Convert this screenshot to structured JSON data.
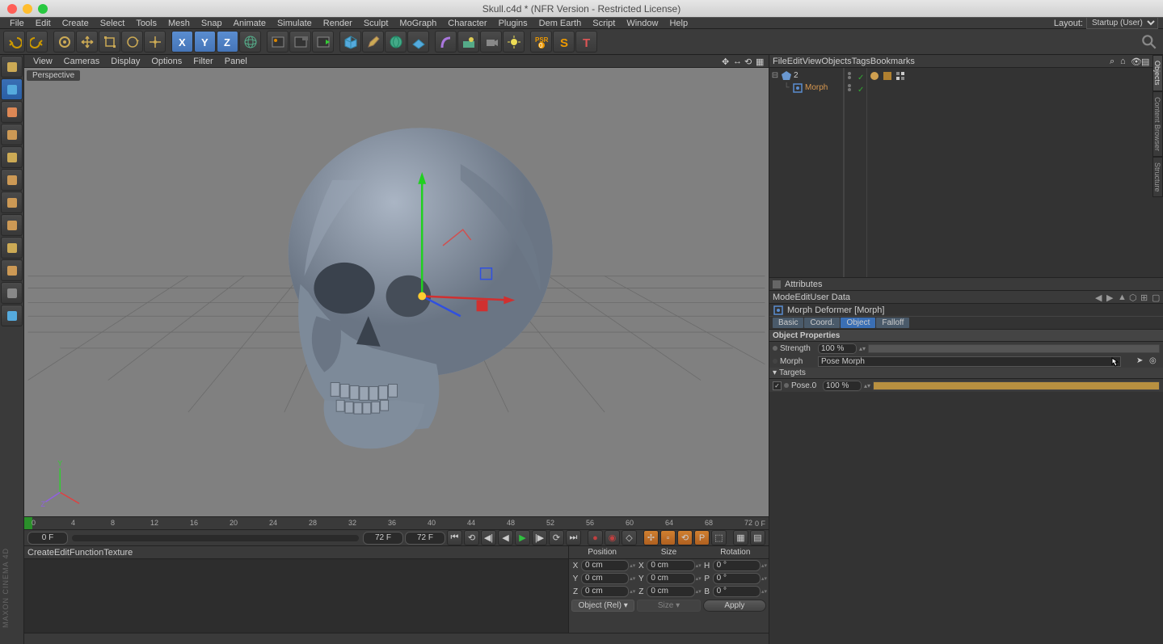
{
  "titlebar": {
    "title": "Skull.c4d * (NFR Version - Restricted License)"
  },
  "menubar": {
    "items": [
      "File",
      "Edit",
      "Create",
      "Select",
      "Tools",
      "Mesh",
      "Snap",
      "Animate",
      "Simulate",
      "Render",
      "Sculpt",
      "MoGraph",
      "Character",
      "Plugins",
      "Dem Earth",
      "Script",
      "Window",
      "Help"
    ],
    "layout_label": "Layout:",
    "layout_value": "Startup (User)"
  },
  "toolbar_icons": [
    "undo",
    "redo",
    "",
    "live-select",
    "move",
    "scale",
    "rotate",
    "recent",
    "",
    "axis-x",
    "axis-y",
    "axis-z",
    "world",
    "",
    "render-view",
    "render-settings",
    "render-queue",
    "",
    "cube",
    "pen",
    "subdiv",
    "floor",
    "",
    "bend",
    "environment",
    "camera",
    "light",
    "",
    "psr",
    "letter-s",
    "letter-t"
  ],
  "leftbar_icons": [
    "make-editable",
    "model",
    "texture",
    "uv",
    "workplane",
    "cube-prim",
    "edge",
    "point",
    "poly",
    "axis",
    "layers",
    "soft"
  ],
  "viewport": {
    "menu": [
      "View",
      "Cameras",
      "Display",
      "Options",
      "Filter",
      "Panel"
    ],
    "label": "Perspective"
  },
  "timeline": {
    "start": "0 F",
    "mid": "72 F",
    "end": "72 F",
    "end2": "0 F",
    "marks": [
      0,
      4,
      8,
      12,
      16,
      20,
      24,
      28,
      32,
      36,
      40,
      44,
      48,
      52,
      56,
      60,
      64,
      68,
      72
    ]
  },
  "bottom_menu": [
    "Create",
    "Edit",
    "Function",
    "Texture"
  ],
  "coords": {
    "headers": [
      "Position",
      "Size",
      "Rotation"
    ],
    "rows": [
      {
        "axis": "X",
        "p": "0 cm",
        "s": "0 cm",
        "r_lbl": "H",
        "r": "0 °"
      },
      {
        "axis": "Y",
        "p": "0 cm",
        "s": "0 cm",
        "r_lbl": "P",
        "r": "0 °"
      },
      {
        "axis": "Z",
        "p": "0 cm",
        "s": "0 cm",
        "r_lbl": "B",
        "r": "0 °"
      }
    ],
    "mode": "Object (Rel)",
    "size_mode": "Size",
    "apply": "Apply"
  },
  "objmgr": {
    "menu": [
      "File",
      "Edit",
      "View",
      "Objects",
      "Tags",
      "Bookmarks"
    ],
    "tree": [
      {
        "level": 0,
        "name": "2",
        "color": "#ccc"
      },
      {
        "level": 1,
        "name": "Morph",
        "color": "#d89850"
      }
    ]
  },
  "attributes": {
    "title": "Attributes",
    "menu": [
      "Mode",
      "Edit",
      "User Data"
    ],
    "item": "Morph Deformer [Morph]",
    "tabs": [
      "Basic",
      "Coord.",
      "Object",
      "Falloff"
    ],
    "active_tab": 2,
    "section": "Object Properties",
    "props": [
      {
        "label": "Strength",
        "value": "100 %",
        "type": "slider"
      },
      {
        "label": "Morph",
        "value": "Pose Morph",
        "type": "link"
      }
    ],
    "targets_header": "Targets",
    "targets": [
      {
        "check": true,
        "label": "Pose.0",
        "value": "100 %"
      }
    ]
  },
  "side_tabs": [
    "Objects",
    "Content Browser",
    "Structure"
  ],
  "maxon": "MAXON CINEMA 4D"
}
